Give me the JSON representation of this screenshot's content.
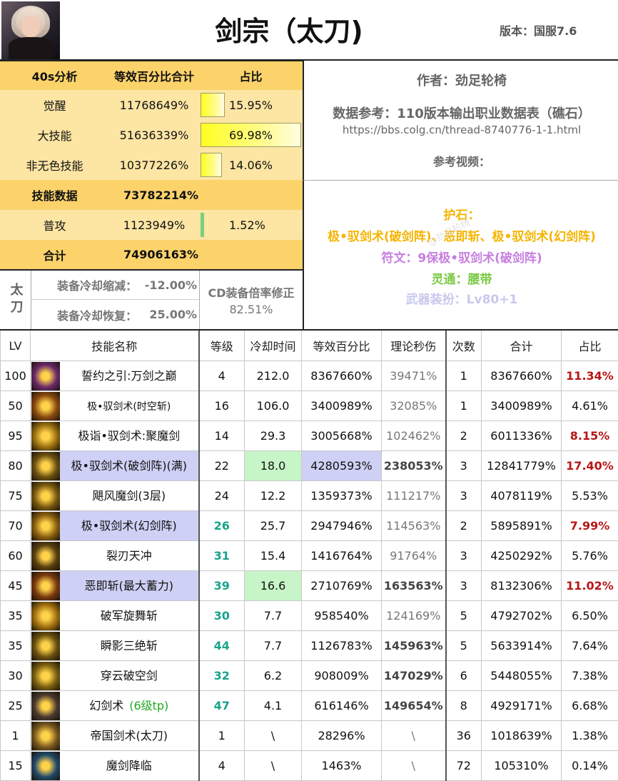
{
  "header": {
    "title": "剑宗（太刀)",
    "version": "版本：国服7.6"
  },
  "summary": {
    "headers": [
      "40s分析",
      "等效百分比合计",
      "占比"
    ],
    "rows": [
      {
        "label": "觉醒",
        "value": "11768649%",
        "ratio": "15.95%",
        "share": 0.1595
      },
      {
        "label": "大技能",
        "value": "51636339%",
        "ratio": "69.98%",
        "share": 0.6998
      },
      {
        "label": "非无色技能",
        "value": "10377226%",
        "ratio": "14.06%",
        "share": 0.1406
      }
    ],
    "skill_data_label": "技能数据",
    "skill_data_value": "73782214%",
    "normal_attack": {
      "label": "普攻",
      "value": "1123949%",
      "ratio": "1.52%",
      "share": 0.0152
    },
    "total_label": "合计",
    "total_value": "74906163%"
  },
  "info": {
    "author": "作者：劲足轮椅",
    "reference": "数据参考：110版本输出职业数据表（礁石）",
    "url": "https://bbs.colg.cn/thread-8740776-1-1.html",
    "video": "参考视频：",
    "stone_label": "护石：",
    "stone_value": "极•驭剑术(破剑阵)、恶即斩、极•驭剑术(幻剑阵)",
    "rune": "符文：9保极•驭剑术(破剑阵)",
    "soul": "灵通：腰带",
    "weapon": "武器装扮：Lv80+1",
    "watermark": "@劲足轮椅"
  },
  "cooldown": {
    "side_label": "太刀",
    "reduce_label": "装备冷却缩减：",
    "reduce_value": "-12.00%",
    "recover_label": "装备冷却恢复：",
    "recover_value": "25.00%",
    "cd_label": "CD装备倍率修正",
    "cd_value": "82.51%"
  },
  "table": {
    "headers": [
      "LV",
      "技能名称",
      "等级",
      "冷却时间",
      "等效百分比",
      "理论秒伤",
      "次数",
      "合计",
      "占比"
    ],
    "rows": [
      {
        "lv": "100",
        "icon": "awakening-icon",
        "name": "誓约之引:万剑之巅",
        "level": "4",
        "cd": "212.0",
        "pct": "8367660%",
        "dps": "39471%",
        "count": "1",
        "total": "8367660%",
        "ratio": "11.34%"
      },
      {
        "lv": "50",
        "icon": "sword-storm-icon",
        "name": "极•驭剑术(时空斩)",
        "level": "16",
        "cd": "106.0",
        "pct": "3400989%",
        "dps": "32085%",
        "count": "1",
        "total": "3400989%",
        "ratio": "4.61%"
      },
      {
        "lv": "95",
        "icon": "demon-sword-icon",
        "name": "极诣•驭剑术:聚魔剑",
        "level": "14",
        "cd": "29.3",
        "pct": "3005668%",
        "dps": "102462%",
        "count": "2",
        "total": "6011336%",
        "ratio": "8.15%"
      },
      {
        "lv": "80",
        "icon": "sword-array-icon",
        "name": "极•驭剑术(破剑阵)(满)",
        "level": "22",
        "cd": "18.0",
        "pct": "4280593%",
        "dps": "238053%",
        "count": "3",
        "total": "12841779%",
        "ratio": "17.40%"
      },
      {
        "lv": "75",
        "icon": "whirlwind-icon",
        "name": "飓风魔剑(3层)",
        "level": "24",
        "cd": "12.2",
        "pct": "1359373%",
        "dps": "111217%",
        "count": "3",
        "total": "4078119%",
        "ratio": "5.53%"
      },
      {
        "lv": "70",
        "icon": "phantom-array-icon",
        "name": "极•驭剑术(幻剑阵)",
        "level": "26",
        "cd": "25.7",
        "pct": "2947946%",
        "dps": "114563%",
        "count": "2",
        "total": "5895891%",
        "ratio": "7.99%"
      },
      {
        "lv": "60",
        "icon": "blade-rise-icon",
        "name": "裂刃天冲",
        "level": "31",
        "cd": "15.4",
        "pct": "1416764%",
        "dps": "91764%",
        "count": "3",
        "total": "4250292%",
        "ratio": "5.76%"
      },
      {
        "lv": "45",
        "icon": "evil-slash-icon",
        "name": "恶即斩(最大蓄力)",
        "level": "39",
        "cd": "16.6",
        "pct": "2710769%",
        "dps": "163563%",
        "count": "3",
        "total": "8132306%",
        "ratio": "11.02%"
      },
      {
        "lv": "35",
        "icon": "crescent-icon",
        "name": "破军旋舞斩",
        "level": "30",
        "cd": "7.7",
        "pct": "958540%",
        "dps": "124169%",
        "count": "5",
        "total": "4792702%",
        "ratio": "6.50%"
      },
      {
        "lv": "35",
        "icon": "triple-slash-icon",
        "name": "瞬影三绝斩",
        "level": "44",
        "cd": "7.7",
        "pct": "1126783%",
        "dps": "145963%",
        "count": "5",
        "total": "5633914%",
        "ratio": "7.64%"
      },
      {
        "lv": "30",
        "icon": "sky-pierce-icon",
        "name": "穿云破空剑",
        "level": "32",
        "cd": "6.2",
        "pct": "908009%",
        "dps": "147029%",
        "count": "6",
        "total": "5448055%",
        "ratio": "7.38%"
      },
      {
        "lv": "25",
        "icon": "phantom-sword-icon",
        "name": "幻剑术",
        "name_note": "(6级tp)",
        "level": "47",
        "cd": "4.1",
        "pct": "616146%",
        "dps": "149654%",
        "count": "8",
        "total": "4929171%",
        "ratio": "6.68%"
      },
      {
        "lv": "1",
        "icon": "empire-sword-icon",
        "name": "帝国剑术(太刀)",
        "level": "1",
        "cd": "\\",
        "pct": "28296%",
        "dps": "\\",
        "count": "36",
        "total": "1018639%",
        "ratio": "1.38%"
      },
      {
        "lv": "15",
        "icon": "sword-descent-icon",
        "name": "魔剑降临",
        "level": "4",
        "cd": "\\",
        "pct": "1463%",
        "dps": "\\",
        "count": "72",
        "total": "105310%",
        "ratio": "0.14%"
      }
    ]
  },
  "colors": {
    "accent_red": "#b81616",
    "teal": "#1aa38a",
    "gold": "#f5b400",
    "violet": "#c77ee0",
    "green": "#7ac943",
    "lavender": "#c8c8ee",
    "header_yellow": "#fcd36b"
  }
}
